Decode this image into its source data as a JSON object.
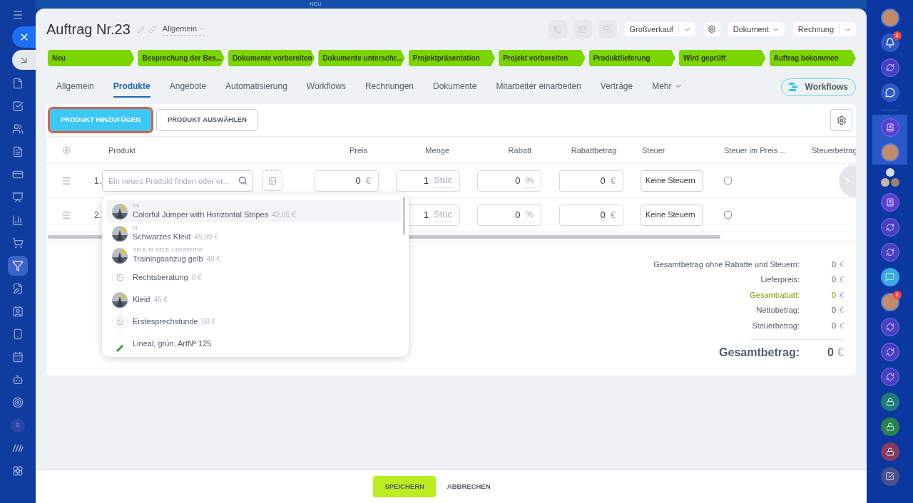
{
  "top_label": "NEU",
  "left_sidebar": [
    {
      "kind": "menu",
      "selected": false
    },
    {
      "kind": "close",
      "selected": false
    },
    {
      "kind": "collapse",
      "selected": false
    },
    {
      "kind": "docs",
      "selected": false
    },
    {
      "kind": "tasks",
      "selected": false
    },
    {
      "kind": "contacts",
      "selected": false
    },
    {
      "kind": "doc",
      "selected": false
    },
    {
      "kind": "card",
      "selected": false
    },
    {
      "kind": "board",
      "selected": false
    },
    {
      "kind": "chart",
      "selected": false
    },
    {
      "kind": "cart",
      "selected": false
    },
    {
      "kind": "funnel",
      "selected": true
    },
    {
      "kind": "doc-edit",
      "selected": false
    },
    {
      "kind": "id-card",
      "selected": false
    },
    {
      "kind": "phone",
      "selected": false
    },
    {
      "kind": "calendar",
      "selected": false
    },
    {
      "kind": "robot",
      "selected": false
    },
    {
      "kind": "target",
      "selected": false
    },
    {
      "kind": "letter",
      "label": "S",
      "selected": false
    },
    {
      "kind": "stripes",
      "selected": false
    },
    {
      "kind": "flower",
      "selected": false
    }
  ],
  "header": {
    "title": "Auftrag Nr.23",
    "category": "Allgemein",
    "preset": "Großverkauf",
    "document": "Dokument",
    "invoice": "Rechnung"
  },
  "pipeline": [
    {
      "label": "Neu",
      "selected": true
    },
    {
      "label": "Besprechung der Bes...",
      "selected": true
    },
    {
      "label": "Dokumente vorbereiten",
      "selected": true
    },
    {
      "label": "Dokumente unterschr...",
      "selected": true
    },
    {
      "label": "Projektpräsentation",
      "selected": true
    },
    {
      "label": "Projekt vorbereiten",
      "selected": true
    },
    {
      "label": "Produktlieferung",
      "selected": true
    },
    {
      "label": "Wird geprüft",
      "selected": true
    },
    {
      "label": "Auftrag bekommen",
      "selected": true
    }
  ],
  "tabs": [
    {
      "label": "Allgemein",
      "selected": false
    },
    {
      "label": "Produkte",
      "selected": true
    },
    {
      "label": "Angebote",
      "selected": false
    },
    {
      "label": "Automatisierung",
      "selected": false
    },
    {
      "label": "Workflows",
      "selected": false
    },
    {
      "label": "Rechnungen",
      "selected": false
    },
    {
      "label": "Dokumente",
      "selected": false
    },
    {
      "label": "Mitarbeiter einarbeiten",
      "selected": false
    },
    {
      "label": "Verträge",
      "selected": false
    },
    {
      "label": "Mehr",
      "selected": false,
      "kind": "more"
    }
  ],
  "workflows_button": "Workflows",
  "toolbar": [
    {
      "label": "PRODUKT HINZUFÜGEN",
      "highlighted": true,
      "kind": "primary"
    },
    {
      "label": "PRODUKT AUSWÄHLEN",
      "highlighted": false,
      "kind": "secondary"
    }
  ],
  "table": {
    "columns": [
      "Produkt",
      "Preis",
      "Menge",
      "Rabatt",
      "Rabattbetrag",
      "Steuer",
      "Steuer im Preis ...",
      "Steuerbetrag"
    ],
    "rows": [
      {
        "number": "1.",
        "product_placeholder": "Ein neues Produkt finden oder er...",
        "price": {
          "value": "0",
          "unit": "€"
        },
        "quantity": {
          "value": "1",
          "unit": "Stüc"
        },
        "discount": {
          "value": "0",
          "unit": "%"
        },
        "discount_amount": {
          "value": "0",
          "unit": "€"
        },
        "tax": "Keine Steuern",
        "tax_included": false
      },
      {
        "number": "2.",
        "quantity": {
          "value": "1",
          "unit": "Stüc"
        },
        "discount": {
          "value": "0",
          "unit": "%"
        },
        "discount_amount": {
          "value": "0",
          "unit": "€"
        },
        "tax": "Keine Steuern",
        "tax_included": false
      }
    ]
  },
  "dropdown": [
    {
      "variant": "XS",
      "name": "Colorful Jumper with Horizontal Stripes",
      "price": "42,05 €",
      "selected": true
    },
    {
      "variant": "XL",
      "name": "Schwarzes Kleid",
      "price": "45,99 €",
      "selected": false
    },
    {
      "variant": "GELB, M, GELB, LINKSSEITIG",
      "name": "Trainingsanzug gelb",
      "price": "49 €",
      "selected": false
    },
    {
      "name": "Rechtsberatung",
      "price": "0 €",
      "kind": "placeholder",
      "selected": false
    },
    {
      "name": "Kleid",
      "price": "45 €",
      "selected": false
    },
    {
      "name": "Erstesprechstunde",
      "price": "50 €",
      "kind": "placeholder",
      "selected": false
    },
    {
      "name": "Lineal, grün, ArtNº 125",
      "kind": "pen",
      "selected": false
    }
  ],
  "totals": [
    {
      "label": "Gesamtbetrag ohne Rabatte und Steuern:",
      "value": "0",
      "currency": "€",
      "highlight": false
    },
    {
      "label": "Lieferpreis:",
      "value": "0",
      "currency": "€",
      "highlight": false
    },
    {
      "label": "Gesamtrabatt:",
      "value": "0",
      "currency": "€",
      "highlight": true
    },
    {
      "label": "Nettobetrag:",
      "value": "0",
      "currency": "€",
      "highlight": false
    },
    {
      "label": "Steuerbetrag:",
      "value": "0",
      "currency": "€",
      "highlight": false
    }
  ],
  "grand_total": {
    "label": "Gesamtbetrag:",
    "value": "0",
    "currency": "€"
  },
  "footer": {
    "save": "SPEICHERN",
    "cancel": "ABBRECHEN"
  },
  "right_rail": [
    {
      "kind": "avatar"
    },
    {
      "kind": "bell",
      "badge": "1"
    },
    {
      "kind": "swirl"
    },
    {
      "kind": "chat"
    },
    {
      "kind": "divider"
    },
    {
      "kind": "book",
      "group": true
    },
    {
      "kind": "avatar",
      "group": true
    },
    {
      "kind": "group"
    },
    {
      "kind": "book"
    },
    {
      "kind": "swirl"
    },
    {
      "kind": "swirl"
    },
    {
      "kind": "messenger"
    },
    {
      "kind": "avatar",
      "badge": "1"
    },
    {
      "kind": "swirl"
    },
    {
      "kind": "swirl"
    },
    {
      "kind": "swirl"
    },
    {
      "kind": "lock",
      "color": "#1f7a7a"
    },
    {
      "kind": "lock",
      "color": "#2b8050"
    },
    {
      "kind": "lock",
      "color": "#8a3a5e"
    },
    {
      "kind": "task"
    }
  ]
}
